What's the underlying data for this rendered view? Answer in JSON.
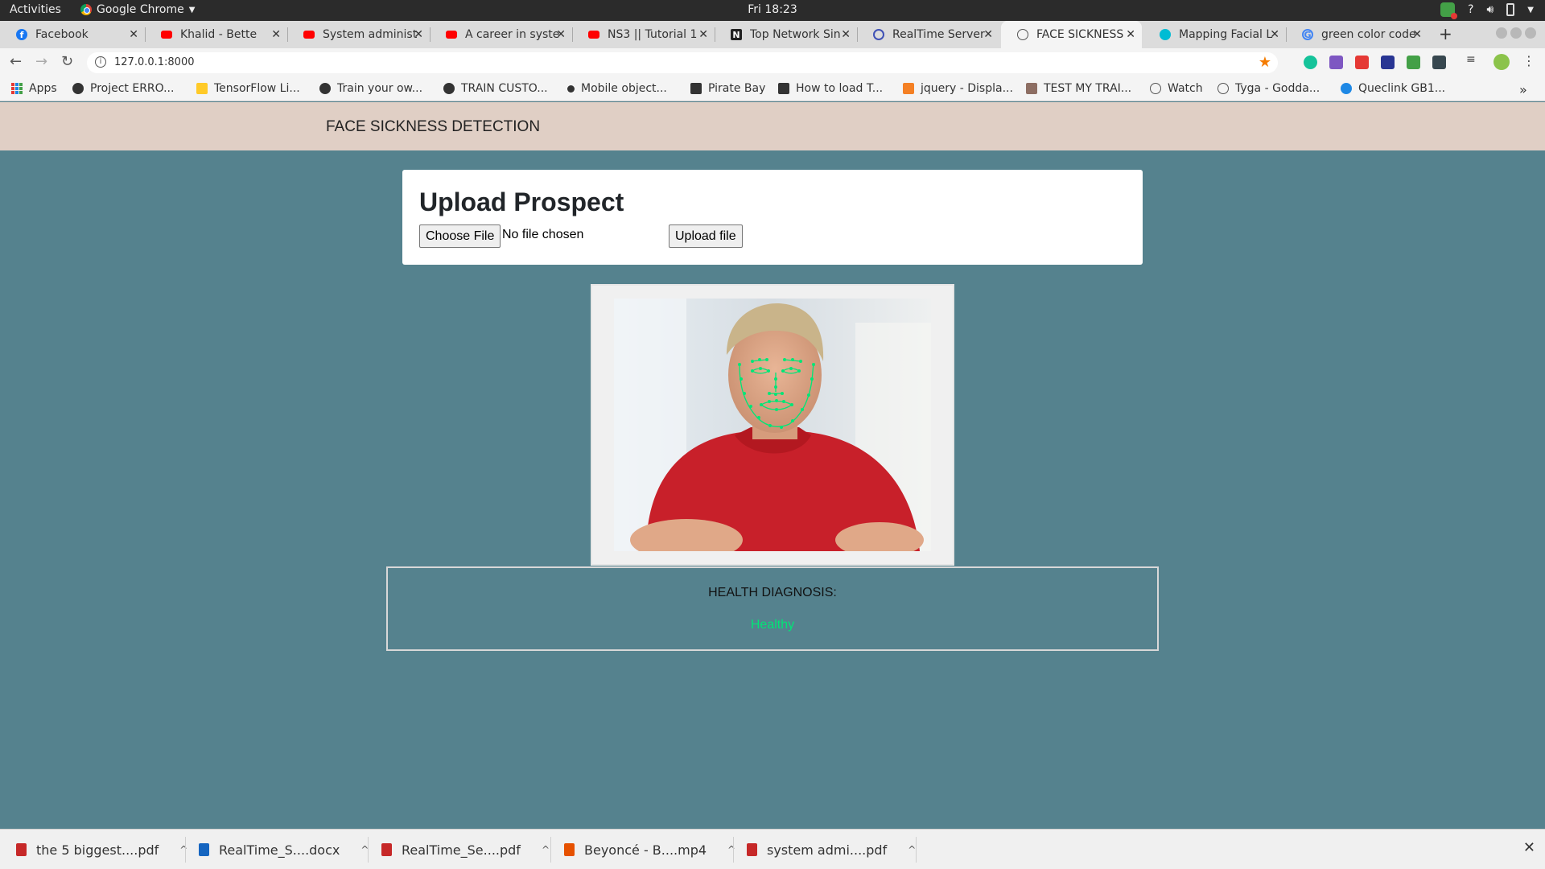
{
  "system_bar": {
    "activities": "Activities",
    "app_name": "Google Chrome",
    "clock": "Fri 18:23",
    "help_icon": "?"
  },
  "tabs": [
    {
      "title": "Facebook",
      "icon": "facebook-icon"
    },
    {
      "title": "Khalid - Bette",
      "icon": "youtube-icon"
    },
    {
      "title": "System administ",
      "icon": "youtube-icon"
    },
    {
      "title": "A career in syste",
      "icon": "youtube-icon"
    },
    {
      "title": "NS3 || Tutorial 1",
      "icon": "youtube-icon"
    },
    {
      "title": "Top Network Sin",
      "icon": "site-icon"
    },
    {
      "title": "RealTime Server",
      "icon": "site-icon"
    },
    {
      "title": "FACE SICKNESS",
      "icon": "globe-icon",
      "active": true
    },
    {
      "title": "Mapping Facial L",
      "icon": "site-icon"
    },
    {
      "title": "green color code",
      "icon": "google-icon"
    }
  ],
  "address_bar": {
    "url": "127.0.0.1:8000"
  },
  "bookmarks": [
    {
      "label": "Apps"
    },
    {
      "label": "Project ERRO..."
    },
    {
      "label": "TensorFlow Li..."
    },
    {
      "label": "Train your ow..."
    },
    {
      "label": "TRAIN CUSTO..."
    },
    {
      "label": "Mobile object..."
    },
    {
      "label": "Pirate Bay"
    },
    {
      "label": "How to load T..."
    },
    {
      "label": "jquery - Displa..."
    },
    {
      "label": "TEST MY TRAI..."
    },
    {
      "label": "Watch"
    },
    {
      "label": "Tyga - Godda..."
    },
    {
      "label": "Queclink GB1..."
    }
  ],
  "page": {
    "brand": "FACE SICKNESS DETECTION",
    "upload_title": "Upload Prospect",
    "choose_file": "Choose File",
    "no_file": "No file chosen",
    "upload_button": "Upload file",
    "diagnosis_label": "HEALTH DIAGNOSIS:",
    "diagnosis_result": "Healthy",
    "result_color": "#00e676"
  },
  "downloads": [
    {
      "name": "the 5 biggest....pdf",
      "type": "pdf"
    },
    {
      "name": "RealTime_S....docx",
      "type": "docx"
    },
    {
      "name": "RealTime_Se....pdf",
      "type": "pdf"
    },
    {
      "name": "Beyoncé - B....mp4",
      "type": "mp4"
    },
    {
      "name": "system admi....pdf",
      "type": "pdf"
    }
  ],
  "colors": {
    "page_bg": "#55828e",
    "navbar_bg": "#e0cfc5",
    "landmark_green": "#00e676"
  }
}
